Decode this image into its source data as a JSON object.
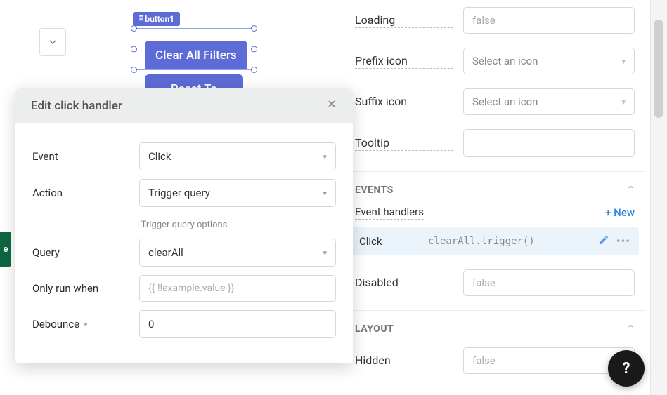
{
  "canvas": {
    "component_tag": "button1",
    "button_label": "Clear All Filters",
    "button2_label": "Reset To"
  },
  "modal": {
    "title": "Edit click handler",
    "fields": {
      "event_label": "Event",
      "event_value": "Click",
      "action_label": "Action",
      "action_value": "Trigger query",
      "divider_text": "Trigger query options",
      "query_label": "Query",
      "query_value": "clearAll",
      "only_run_label": "Only run when",
      "only_run_placeholder": "{{ !!example.value }}",
      "debounce_label": "Debounce",
      "debounce_value": "0"
    }
  },
  "right_panel": {
    "props": {
      "loading_label": "Loading",
      "loading_value": "false",
      "prefix_label": "Prefix icon",
      "prefix_value": "Select an icon",
      "suffix_label": "Suffix icon",
      "suffix_value": "Select an icon",
      "tooltip_label": "Tooltip",
      "tooltip_value": ""
    },
    "events_section": "EVENTS",
    "handlers_label": "Event handlers",
    "new_label": "+ New",
    "handler": {
      "event": "Click",
      "code": "clearAll.trigger()"
    },
    "disabled_label": "Disabled",
    "disabled_value": "false",
    "layout_section": "LAYOUT",
    "hidden_label": "Hidden",
    "hidden_value": "false"
  },
  "strip_letter": "e"
}
